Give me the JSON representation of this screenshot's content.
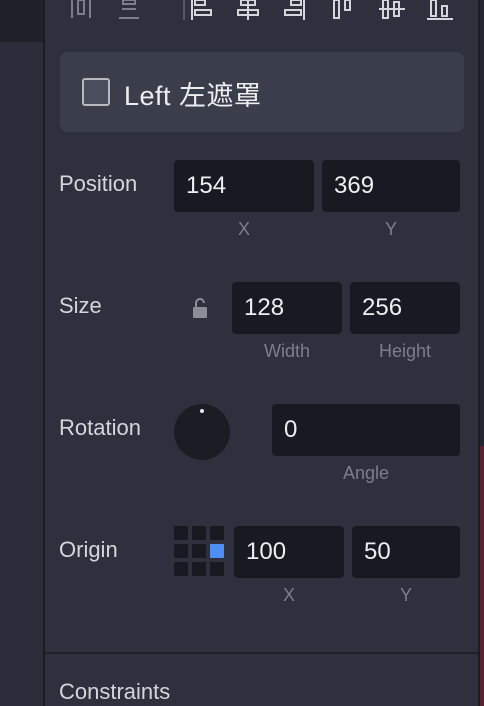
{
  "layer": {
    "name": "Left 左遮罩",
    "checked": false
  },
  "position": {
    "label": "Position",
    "x_value": "154",
    "y_value": "369",
    "x_caption": "X",
    "y_caption": "Y"
  },
  "size": {
    "label": "Size",
    "width_value": "128",
    "height_value": "256",
    "width_caption": "Width",
    "height_caption": "Height",
    "lock_icon": "lock-open-icon"
  },
  "rotation": {
    "label": "Rotation",
    "angle_value": "0",
    "angle_caption": "Angle"
  },
  "origin": {
    "label": "Origin",
    "x_value": "100",
    "y_value": "50",
    "x_caption": "X",
    "y_caption": "Y",
    "active_cell": 5
  },
  "constraints": {
    "label": "Constraints"
  },
  "align_icons": [
    "distribute-vertical-icon",
    "distribute-center-icon",
    "align-left-icon",
    "align-horizontal-center-icon",
    "align-right-icon",
    "align-top-icon",
    "align-vertical-center-icon",
    "align-bottom-icon"
  ],
  "colors": {
    "accent": "#4e8ef7",
    "panel": "#2e313d",
    "field": "#181a21"
  }
}
